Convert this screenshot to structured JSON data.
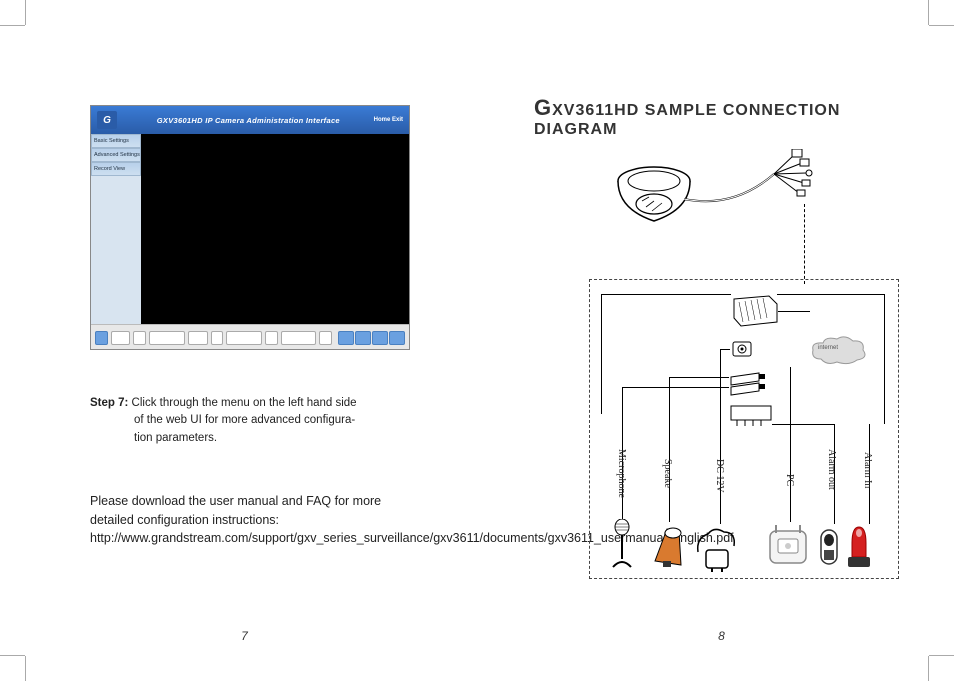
{
  "left": {
    "screenshot": {
      "header_title": "GXV3601HD IP Camera Administration Interface",
      "header_right": "Home   Exit",
      "menu": [
        "Basic Settings",
        "Advanced Settings",
        "Record View"
      ]
    },
    "step": {
      "label": "Step 7:",
      "line1": "Click through the menu on the left hand side",
      "line2": "of the web UI for more advanced configura-",
      "line3": "tion parameters."
    },
    "download": "Please download the user manual and FAQ for more detailed configuration instructions: http://www.grandstream.com/support/gxv_series_surveillance/gxv3611/documents/gxv3611_usermanual_english.pdf",
    "page_num": "7"
  },
  "right": {
    "title_prefix": "G",
    "title_rest": "XV3611HD SAMPLE CONNECTION DIAGRAM",
    "labels": {
      "microphone": "Microphone",
      "speaker": "Speake",
      "dc12v": "DC 12V",
      "pc": "PC",
      "alarm_out": "Alarm out",
      "alarm_in": "Alarm In",
      "internet": "internet"
    },
    "page_num": "8"
  }
}
